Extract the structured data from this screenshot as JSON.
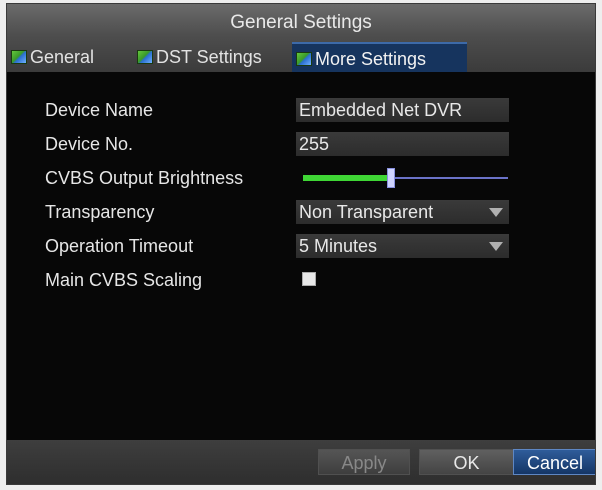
{
  "dialog": {
    "title": "General Settings"
  },
  "tabs": [
    {
      "label": "General",
      "icon": "grid-icon",
      "active": false
    },
    {
      "label": "DST Settings",
      "icon": "grid-icon",
      "active": false
    },
    {
      "label": "More Settings",
      "icon": "grid-icon",
      "active": true
    }
  ],
  "fields": {
    "device_name": {
      "label": "Device Name",
      "value": "Embedded Net DVR"
    },
    "device_no": {
      "label": "Device No.",
      "value": "255"
    },
    "cvbs_brightness": {
      "label": "CVBS Output Brightness",
      "level": 0.43
    },
    "transparency": {
      "label": "Transparency",
      "value": "Non Transparent"
    },
    "operation_timeout": {
      "label": "Operation Timeout",
      "value": "5 Minutes"
    },
    "main_cvbs_scaling": {
      "label": "Main CVBS Scaling",
      "checked": false
    }
  },
  "footer": {
    "apply_label": "Apply",
    "ok_label": "OK",
    "cancel_label": "Cancel"
  },
  "colors": {
    "accent_blue": "#16345e",
    "slider_fill": "#3fd635",
    "slider_track": "#6a72c8"
  }
}
